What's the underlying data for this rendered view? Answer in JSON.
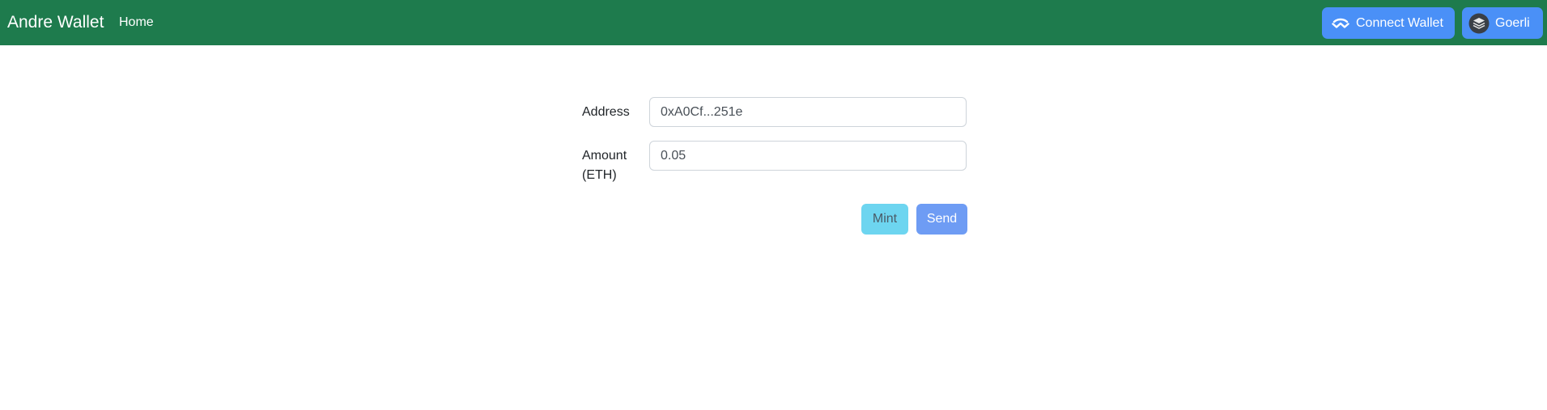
{
  "navbar": {
    "brand": "Andre Wallet",
    "home_link": "Home",
    "connect_wallet_label": "Connect Wallet",
    "connect_wallet_icon": "walletconnect-icon",
    "network_label": "Goerli",
    "network_icon": "network-layers-icon",
    "background_color": "#1e7b4d",
    "button_color": "#4a90f7"
  },
  "form": {
    "address_label": "Address",
    "address_value": "0xA0Cf...251e",
    "amount_label": "Amount (ETH)",
    "amount_value": "0.05",
    "mint_label": "Mint",
    "send_label": "Send",
    "mint_color": "#6dd5f0",
    "send_color": "#6e9cf4"
  }
}
